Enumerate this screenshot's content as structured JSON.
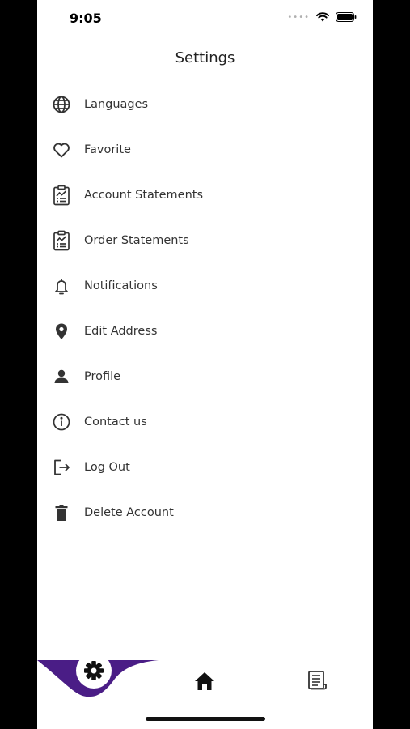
{
  "status_bar": {
    "time": "9:05"
  },
  "header": {
    "title": "Settings"
  },
  "menu": {
    "items": [
      {
        "label": "Languages",
        "icon": "globe-icon"
      },
      {
        "label": "Favorite",
        "icon": "heart-icon"
      },
      {
        "label": "Account Statements",
        "icon": "clipboard-chart-icon"
      },
      {
        "label": "Order Statements",
        "icon": "clipboard-chart-icon"
      },
      {
        "label": "Notifications",
        "icon": "bell-icon"
      },
      {
        "label": "Edit Address",
        "icon": "location-pin-icon"
      },
      {
        "label": "Profile",
        "icon": "person-icon"
      },
      {
        "label": "Contact us",
        "icon": "info-icon"
      },
      {
        "label": "Log Out",
        "icon": "logout-icon"
      },
      {
        "label": "Delete Account",
        "icon": "trash-icon"
      }
    ]
  },
  "tab_bar": {
    "tabs": [
      {
        "icon": "gear-icon",
        "active": true
      },
      {
        "icon": "home-icon",
        "active": false
      },
      {
        "icon": "news-icon",
        "active": false
      }
    ],
    "accent_color": "#4a1d86"
  }
}
